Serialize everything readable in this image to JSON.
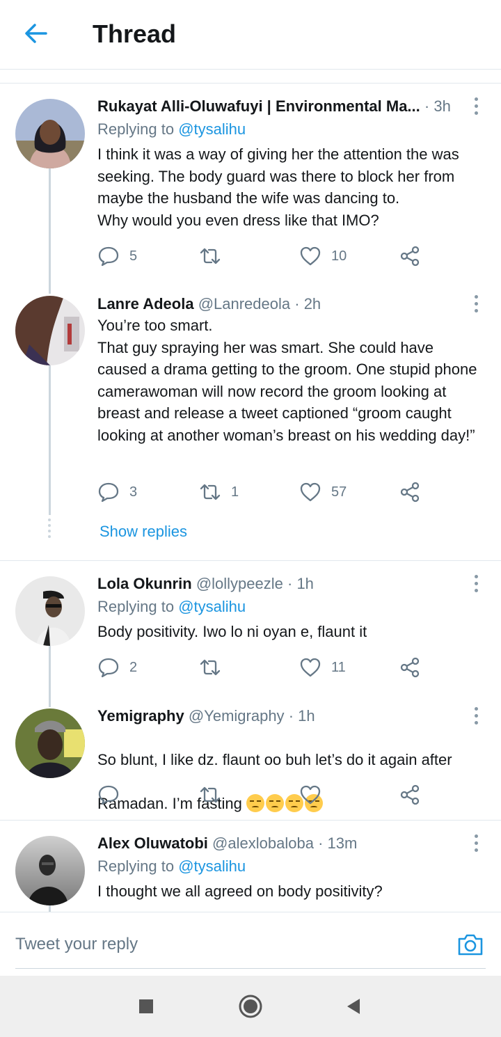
{
  "header": {
    "title": "Thread"
  },
  "tweets": [
    {
      "name": "Rukayat Alli-Oluwafuyi | Environmental Ma...",
      "handle": "",
      "time": "· 3h",
      "replying_prefix": "Replying to ",
      "replying_to": "@tysalihu",
      "text": "I think it was a way of giving her the attention the was seeking. The body guard was there to block her from maybe the husband the wife was dancing to.\nWhy would you even dress like that IMO?",
      "replies": "5",
      "retweets": "",
      "likes": "10"
    },
    {
      "name": "Lanre Adeola",
      "handle": "@Lanredeola",
      "time": "· 2h",
      "text": "You’re too smart.\nThat guy spraying her was smart. She could have caused a drama getting to the groom. One stupid phone camerawoman will now record the groom looking at breast and release a tweet captioned “groom caught looking at another woman’s breast on his wedding day!”",
      "replies": "3",
      "retweets": "1",
      "likes": "57"
    },
    {
      "name": "Lola Okunrin",
      "handle": "@lollypeezle",
      "time": "· 1h",
      "replying_prefix": "Replying to ",
      "replying_to": "@tysalihu",
      "text": "Body positivity. Iwo lo ni oyan e, flaunt it",
      "replies": "2",
      "retweets": "",
      "likes": "11"
    },
    {
      "name": "Yemigraphy",
      "handle": "@Yemigraphy",
      "time": "· 1h",
      "text_line1": "So blunt, I like dz. flaunt oo buh let’s do it again after",
      "text_line2": "Ramadan. I’m fasting ",
      "emojis": [
        "disappointed-face",
        "disappointed-face",
        "unamused-face",
        "unamused-face"
      ],
      "replies": "",
      "retweets": "",
      "likes": ""
    },
    {
      "name": "Alex Oluwatobi",
      "handle": "@alexlobaloba",
      "time": "· 13m",
      "replying_prefix": "Replying to ",
      "replying_to": "@tysalihu",
      "text": "I thought we all agreed on body positivity?"
    }
  ],
  "show_replies": "Show replies",
  "reply_bar": {
    "placeholder": "Tweet your reply"
  },
  "icons": {
    "back": "arrow-left-icon",
    "more": "more-vertical-icon",
    "reply": "comment-icon",
    "retweet": "retweet-icon",
    "like": "heart-icon",
    "share": "share-icon",
    "camera": "camera-icon",
    "nav_recent": "square-icon",
    "nav_home": "circle-icon",
    "nav_back": "triangle-back-icon"
  },
  "colors": {
    "accent": "#1b95e0",
    "muted": "#657786",
    "text": "#14171a",
    "divider": "#e1e8ed"
  }
}
